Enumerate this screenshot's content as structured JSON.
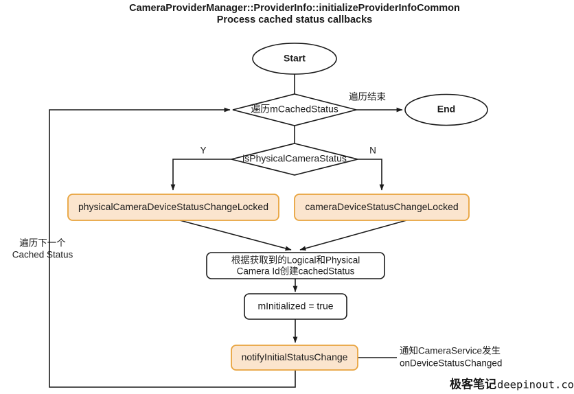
{
  "diagram": {
    "title_line1": "CameraProviderManager::ProviderInfo::initializeProviderInfoCommon",
    "title_line2": "Process cached status callbacks",
    "colors": {
      "accent_fill": "#fbe5ce",
      "accent_stroke": "#e8a33d",
      "line": "#1a1a1a",
      "background": "#ffffff"
    },
    "nodes": {
      "start": {
        "label": "Start",
        "shape": "ellipse"
      },
      "end": {
        "label": "End",
        "shape": "ellipse"
      },
      "loop_decision": {
        "label": "遍历mCachedStatus",
        "shape": "diamond"
      },
      "physical_decision": {
        "label": "isPhysicalCameraStatus",
        "shape": "diamond"
      },
      "physical_status_change": {
        "label": "physicalCameraDeviceStatusChangeLocked",
        "shape": "rounded-rect",
        "accent": true
      },
      "camera_status_change": {
        "label": "cameraDeviceStatusChangeLocked",
        "shape": "rounded-rect",
        "accent": true
      },
      "create_cached_status": {
        "label_line1": "根据获取到的Logical和Physical",
        "label_line2": "Camera Id创建cachedStatus",
        "shape": "rounded-rect"
      },
      "set_initialized": {
        "label": "mInitialized = true",
        "shape": "rounded-rect"
      },
      "notify_initial_status": {
        "label": "notifyInitialStatusChange",
        "shape": "rounded-rect",
        "accent": true
      }
    },
    "edge_labels": {
      "traverse_end": "遍历结束",
      "yes": "Y",
      "no": "N",
      "loop_back_line1": "遍历下一个",
      "loop_back_line2": "Cached Status"
    },
    "notes": {
      "notify_note_line1": "通知CameraService发生",
      "notify_note_line2": "onDeviceStatusChanged"
    }
  },
  "watermark": {
    "cn": "极客笔记",
    "domain": "deepinout.com"
  }
}
